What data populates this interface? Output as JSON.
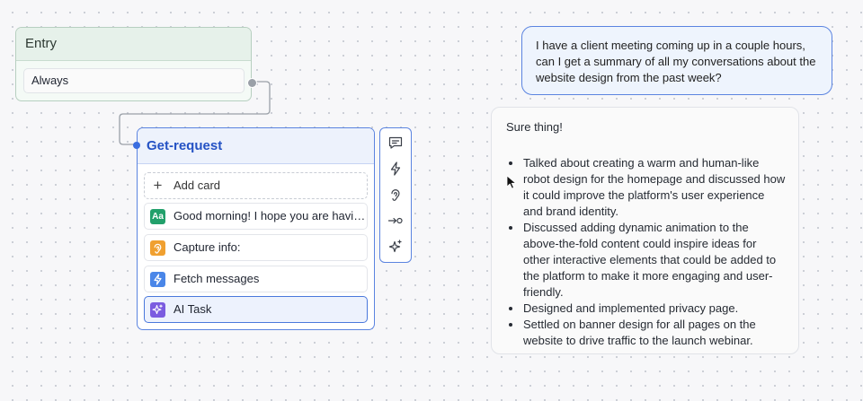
{
  "entry": {
    "title": "Entry",
    "trigger": "Always"
  },
  "get_request": {
    "title": "Get-request",
    "cards": [
      {
        "label": "Add card",
        "icon": "plus-icon",
        "kind": "add"
      },
      {
        "label": "Good morning! I hope you are having a great day",
        "icon": "text-icon",
        "icon_text": "Aa",
        "color": "#22a06b"
      },
      {
        "label": "Capture info:",
        "icon": "ear-icon",
        "color": "#f0a030"
      },
      {
        "label": "Fetch messages",
        "icon": "lightning-icon",
        "color": "#4a86e8"
      },
      {
        "label": "AI Task",
        "icon": "sparkle-icon",
        "color": "#7b5ce0",
        "selected": true
      }
    ]
  },
  "toolbar": {
    "items": [
      "message-icon",
      "lightning-icon",
      "ear-icon",
      "arrow-right-icon",
      "sparkle-icon"
    ]
  },
  "chat": {
    "user_message": "I have a client meeting coming up in a couple hours, can I get a summary of all my conversations about the website design from the past week?",
    "reply_intro": "Sure thing!",
    "reply_bullets": [
      "Talked about creating a warm and human-like robot design for the homepage and discussed how it could improve the platform's user experience and brand identity.",
      "Discussed adding dynamic animation to the above-the-fold content could inspire ideas for other interactive elements that could be added to the platform to make it more engaging and user-friendly.",
      "Designed and implemented privacy page.",
      "Settled on banner design for all pages on the website to drive traffic to the launch webinar."
    ]
  },
  "colors": {
    "accent": "#3b6ee0",
    "entry_bg": "#e6f1ea"
  }
}
